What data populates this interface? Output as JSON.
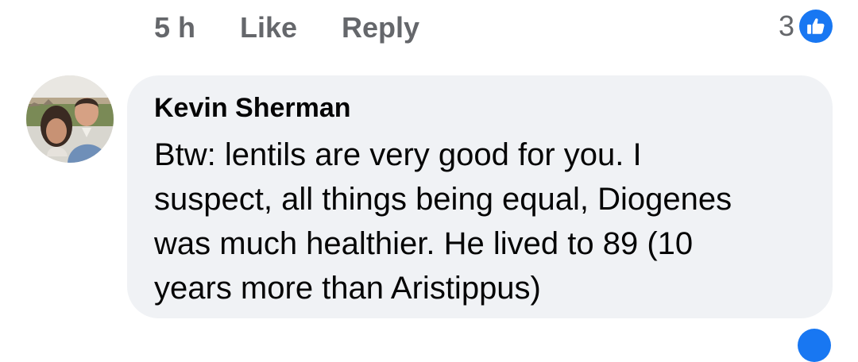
{
  "comment_actions": {
    "timestamp": "5 h",
    "like_label": "Like",
    "reply_label": "Reply",
    "reaction_count": "3",
    "reaction_icon": "thumbs-up-icon"
  },
  "comment": {
    "author": "Kevin Sherman",
    "text": "Btw: lentils are very good for you.  I\nsuspect, all things being equal, Diogenes\nwas much healthier.  He lived to 89 (10\nyears more than Aristippus)"
  },
  "colors": {
    "accent": "#1877f2",
    "bubble_background": "#f0f2f5",
    "meta_text": "#65676b",
    "body_text": "#050505"
  }
}
